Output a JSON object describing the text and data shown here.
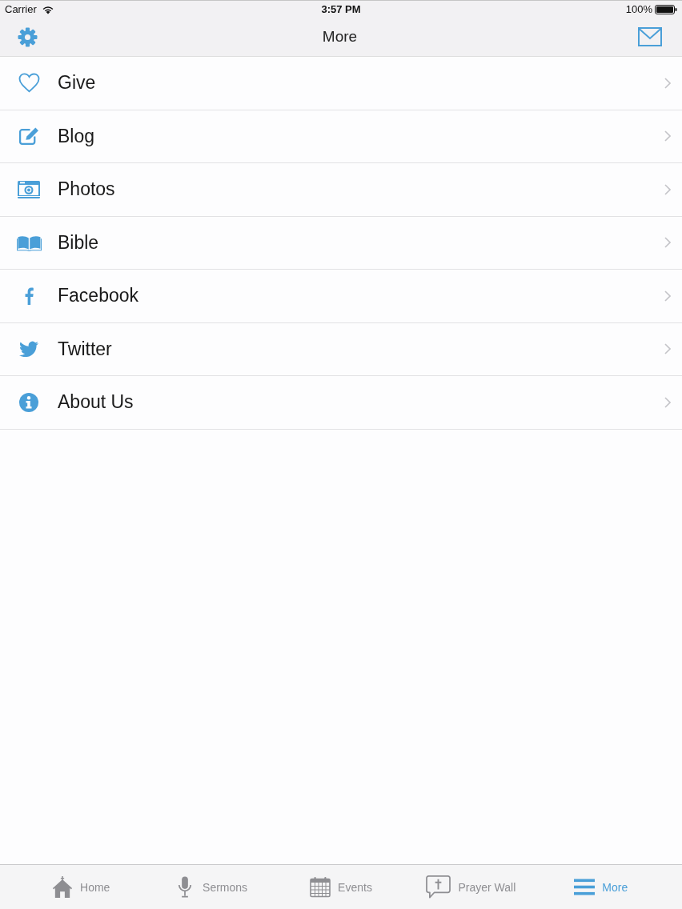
{
  "status_bar": {
    "carrier": "Carrier",
    "time": "3:57 PM",
    "battery": "100%"
  },
  "nav_bar": {
    "title": "More"
  },
  "menu": [
    {
      "label": "Give",
      "kind": "heart"
    },
    {
      "label": "Blog",
      "kind": "pencil"
    },
    {
      "label": "Photos",
      "kind": "camera"
    },
    {
      "label": "Bible",
      "kind": "book"
    },
    {
      "label": "Facebook",
      "kind": "letter-f"
    },
    {
      "label": "Twitter",
      "kind": "bird"
    },
    {
      "label": "About Us",
      "kind": "info"
    }
  ],
  "tab_bar": [
    {
      "label": "Home",
      "kind": "house",
      "selected": false
    },
    {
      "label": "Sermons",
      "kind": "microphone",
      "selected": false
    },
    {
      "label": "Events",
      "kind": "calendar",
      "selected": false
    },
    {
      "label": "Prayer Wall",
      "kind": "speech-cross",
      "selected": false
    },
    {
      "label": "More",
      "kind": "lines",
      "selected": true
    }
  ]
}
